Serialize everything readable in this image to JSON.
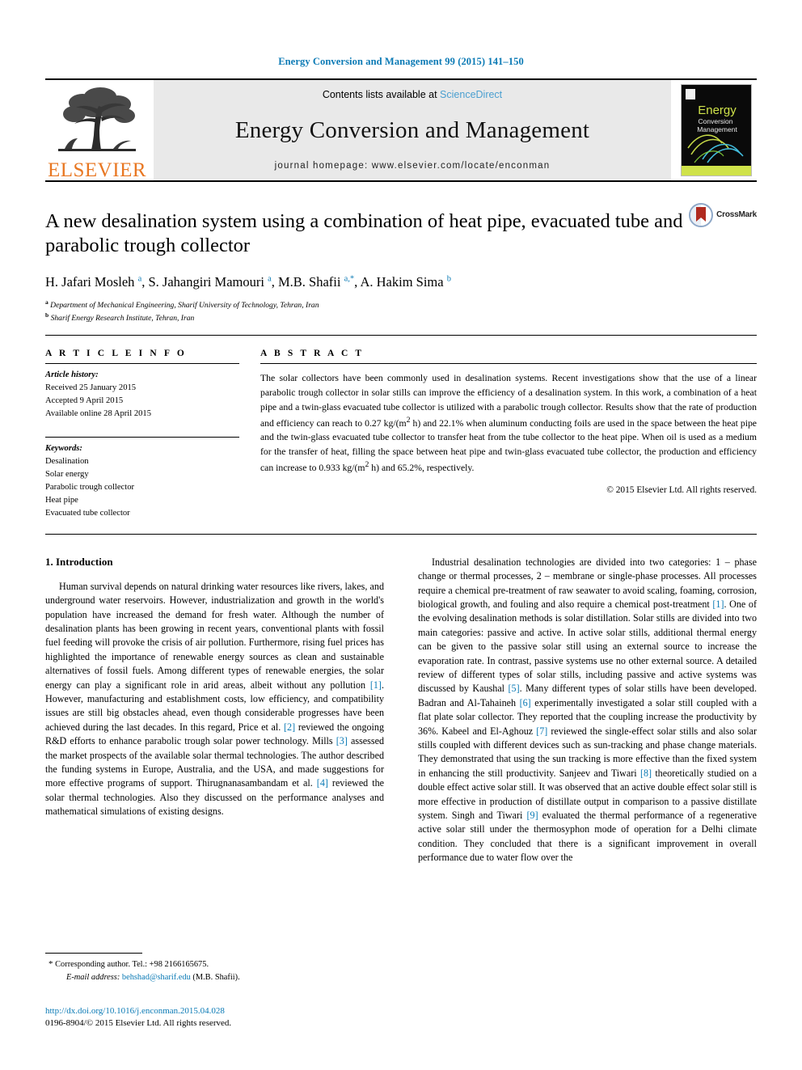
{
  "running_head": "Energy Conversion and Management 99 (2015) 141–150",
  "masthead": {
    "contents_prefix": "Contents lists available at",
    "sciencedirect": "ScienceDirect",
    "journal_title": "Energy Conversion and Management",
    "homepage_label": "journal homepage: www.elsevier.com/locate/enconman",
    "publisher_name": "ELSEVIER",
    "cover": {
      "line1": "Energy",
      "line2": "Conversion",
      "line3": "Management"
    }
  },
  "article": {
    "title": "A new desalination system using a combination of heat pipe, evacuated tube and parabolic trough collector",
    "crossmark_label": "CrossMark",
    "authors_html": "H. Jafari Mosleh <sup>a</sup>, S. Jahangiri Mamouri <sup>a</sup>, M.B. Shafii <sup>a,*</sup>, A. Hakim Sima <sup>b</sup>",
    "affiliation_a": "Department of Mechanical Engineering, Sharif University of Technology, Tehran, Iran",
    "affiliation_b": "Sharif Energy Research Institute, Tehran, Iran"
  },
  "article_info": {
    "heading": "A R T I C L E     I N F O",
    "history_label": "Article history:",
    "history": [
      "Received 25 January 2015",
      "Accepted 9 April 2015",
      "Available online 28 April 2015"
    ],
    "keywords_label": "Keywords:",
    "keywords": [
      "Desalination",
      "Solar energy",
      "Parabolic trough collector",
      "Heat pipe",
      "Evacuated tube collector"
    ]
  },
  "abstract": {
    "heading": "A B S T R A C T",
    "paragraph_html": "The solar collectors have been commonly used in desalination systems. Recent investigations show that the use of a linear parabolic trough collector in solar stills can improve the efficiency of a desalination system. In this work, a combination of a heat pipe and a twin-glass evacuated tube collector is utilized with a parabolic trough collector. Results show that the rate of production and efficiency can reach to 0.27 kg/(m<sup>2</sup> h) and 22.1% when aluminum conducting foils are used in the space between the heat pipe and the twin-glass evacuated tube collector to transfer heat from the tube collector to the heat pipe. When oil is used as a medium for the transfer of heat, filling the space between heat pipe and twin-glass evacuated tube collector, the production and efficiency can increase to 0.933 kg/(m<sup>2</sup> h) and 65.2%, respectively.",
    "copyright": "© 2015 Elsevier Ltd. All rights reserved."
  },
  "body": {
    "section_heading": "1. Introduction",
    "left_paragraph_html": "Human survival depends on natural drinking water resources like rivers, lakes, and underground water reservoirs. However, industrialization and growth in the world's population have increased the demand for fresh water. Although the number of desalination plants has been growing in recent years, conventional plants with fossil fuel feeding will provoke the crisis of air pollution. Furthermore, rising fuel prices has highlighted the importance of renewable energy sources as clean and sustainable alternatives of fossil fuels. Among different types of renewable energies, the solar energy can play a significant role in arid areas, albeit without any pollution <span class=\"ref\">[1]</span>. However, manufacturing and establishment costs, low efficiency, and compatibility issues are still big obstacles ahead, even though considerable progresses have been achieved during the last decades. In this regard, Price et al. <span class=\"ref\">[2]</span> reviewed the ongoing R&amp;D efforts to enhance parabolic trough solar power technology. Mills <span class=\"ref\">[3]</span> assessed the market prospects of the available solar thermal technologies. The author described the funding systems in Europe, Australia, and the USA, and made suggestions for more effective programs of support. Thirugnanasambandam et al. <span class=\"ref\">[4]</span> reviewed the solar thermal technologies. Also they discussed on the performance analyses and mathematical simulations of existing designs.",
    "right_paragraph_html": "Industrial desalination technologies are divided into two categories: 1 – phase change or thermal processes, 2 – membrane or single-phase processes. All processes require a chemical pre-treatment of raw seawater to avoid scaling, foaming, corrosion, biological growth, and fouling and also require a chemical post-treatment <span class=\"ref\">[1]</span>. One of the evolving desalination methods is solar distillation. Solar stills are divided into two main categories: passive and active. In active solar stills, additional thermal energy can be given to the passive solar still using an external source to increase the evaporation rate. In contrast, passive systems use no other external source. A detailed review of different types of solar stills, including passive and active systems was discussed by Kaushal <span class=\"ref\">[5]</span>. Many different types of solar stills have been developed. Badran and Al-Tahaineh <span class=\"ref\">[6]</span> experimentally investigated a solar still coupled with a flat plate solar collector. They reported that the coupling increase the productivity by 36%. Kabeel and El-Aghouz <span class=\"ref\">[7]</span> reviewed the single-effect solar stills and also solar stills coupled with different devices such as sun-tracking and phase change materials. They demonstrated that using the sun tracking is more effective than the fixed system in enhancing the still productivity. Sanjeev and Tiwari <span class=\"ref\">[8]</span> theoretically studied on a double effect active solar still. It was observed that an active double effect solar still is more effective in production of distillate output in comparison to a passive distillate system. Singh and Tiwari <span class=\"ref\">[9]</span> evaluated the thermal performance of a regenerative active solar still under the thermosyphon mode of operation for a Delhi climate condition. They concluded that there is a significant improvement in overall performance due to water flow over the"
  },
  "footnotes": {
    "corresponding": "Corresponding author. Tel.: +98 2166165675.",
    "email_label": "E-mail address:",
    "email": "behshad@sharif.edu",
    "email_suffix": "(M.B. Shafii).",
    "doi": "http://dx.doi.org/10.1016/j.enconman.2015.04.028",
    "issn": "0196-8904/© 2015 Elsevier Ltd. All rights reserved."
  },
  "colors": {
    "link_blue": "#0b7ab5",
    "sciencedirect_blue": "#4a9fd0",
    "elsevier_orange": "#e87722",
    "masthead_gray": "#e9e9e9"
  }
}
